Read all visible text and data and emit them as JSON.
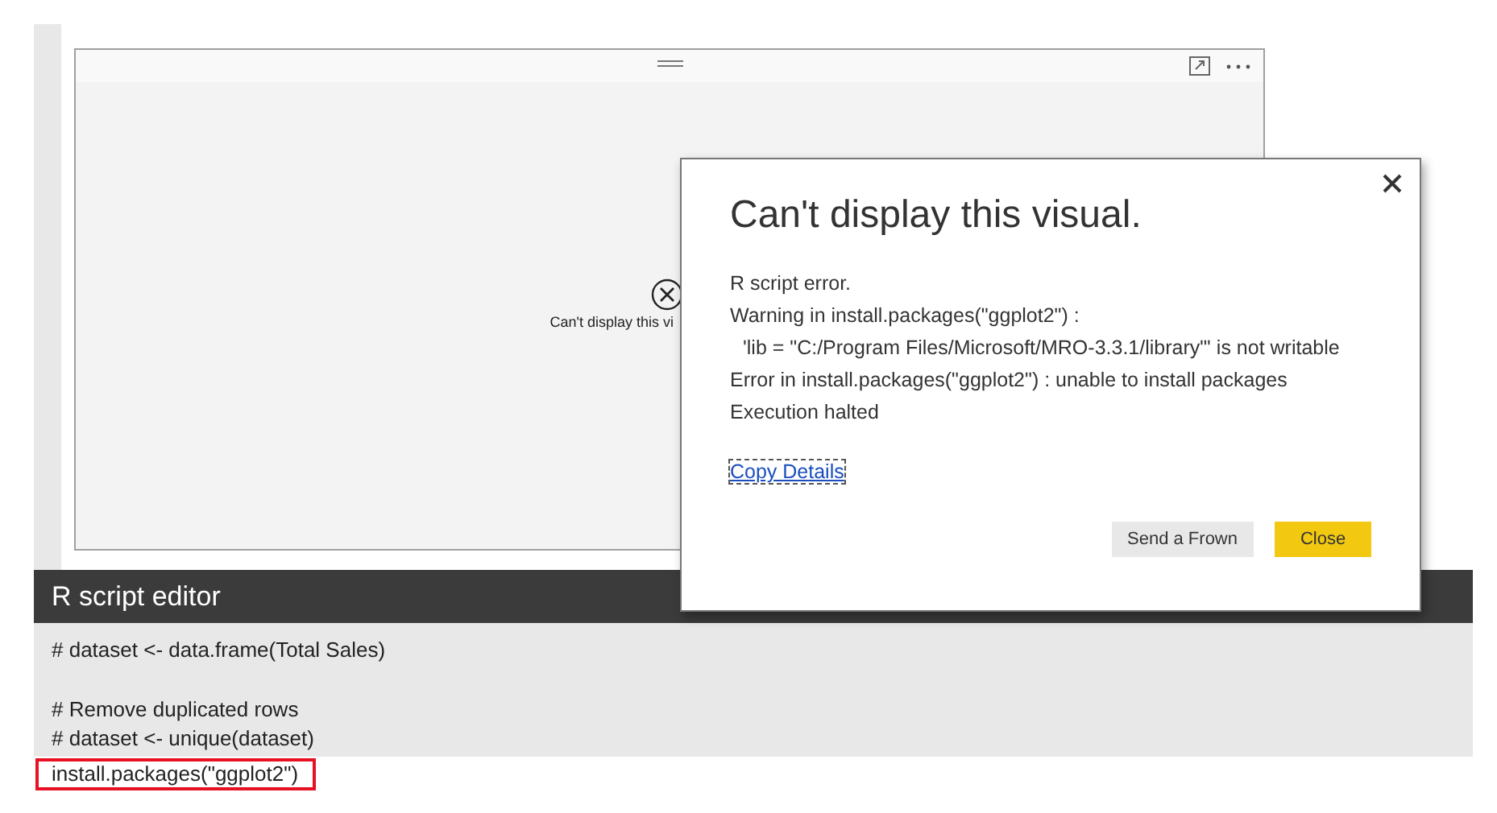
{
  "visual": {
    "error_text": "Can't display this vi"
  },
  "editor": {
    "title": "R script editor",
    "code_blocks": [
      [
        "# dataset <- data.frame(Total Sales)"
      ],
      [
        "# Remove duplicated rows",
        "# dataset <- unique(dataset)"
      ]
    ],
    "highlighted_line": "install.packages(\"ggplot2\")"
  },
  "dialog": {
    "title": "Can't display this visual.",
    "lines": [
      {
        "text": "R script error.",
        "indented": false
      },
      {
        "text": "Warning in install.packages(\"ggplot2\") :",
        "indented": false
      },
      {
        "text": "'lib = \"C:/Program Files/Microsoft/MRO-3.3.1/library\"' is not writable",
        "indented": true
      },
      {
        "text": "Error in install.packages(\"ggplot2\") : unable to install packages",
        "indented": false
      },
      {
        "text": "Execution halted",
        "indented": false
      }
    ],
    "link": "Copy Details",
    "buttons": [
      {
        "label": "Send a Frown",
        "kind": "secondary"
      },
      {
        "label": "Close",
        "kind": "primary"
      }
    ]
  }
}
